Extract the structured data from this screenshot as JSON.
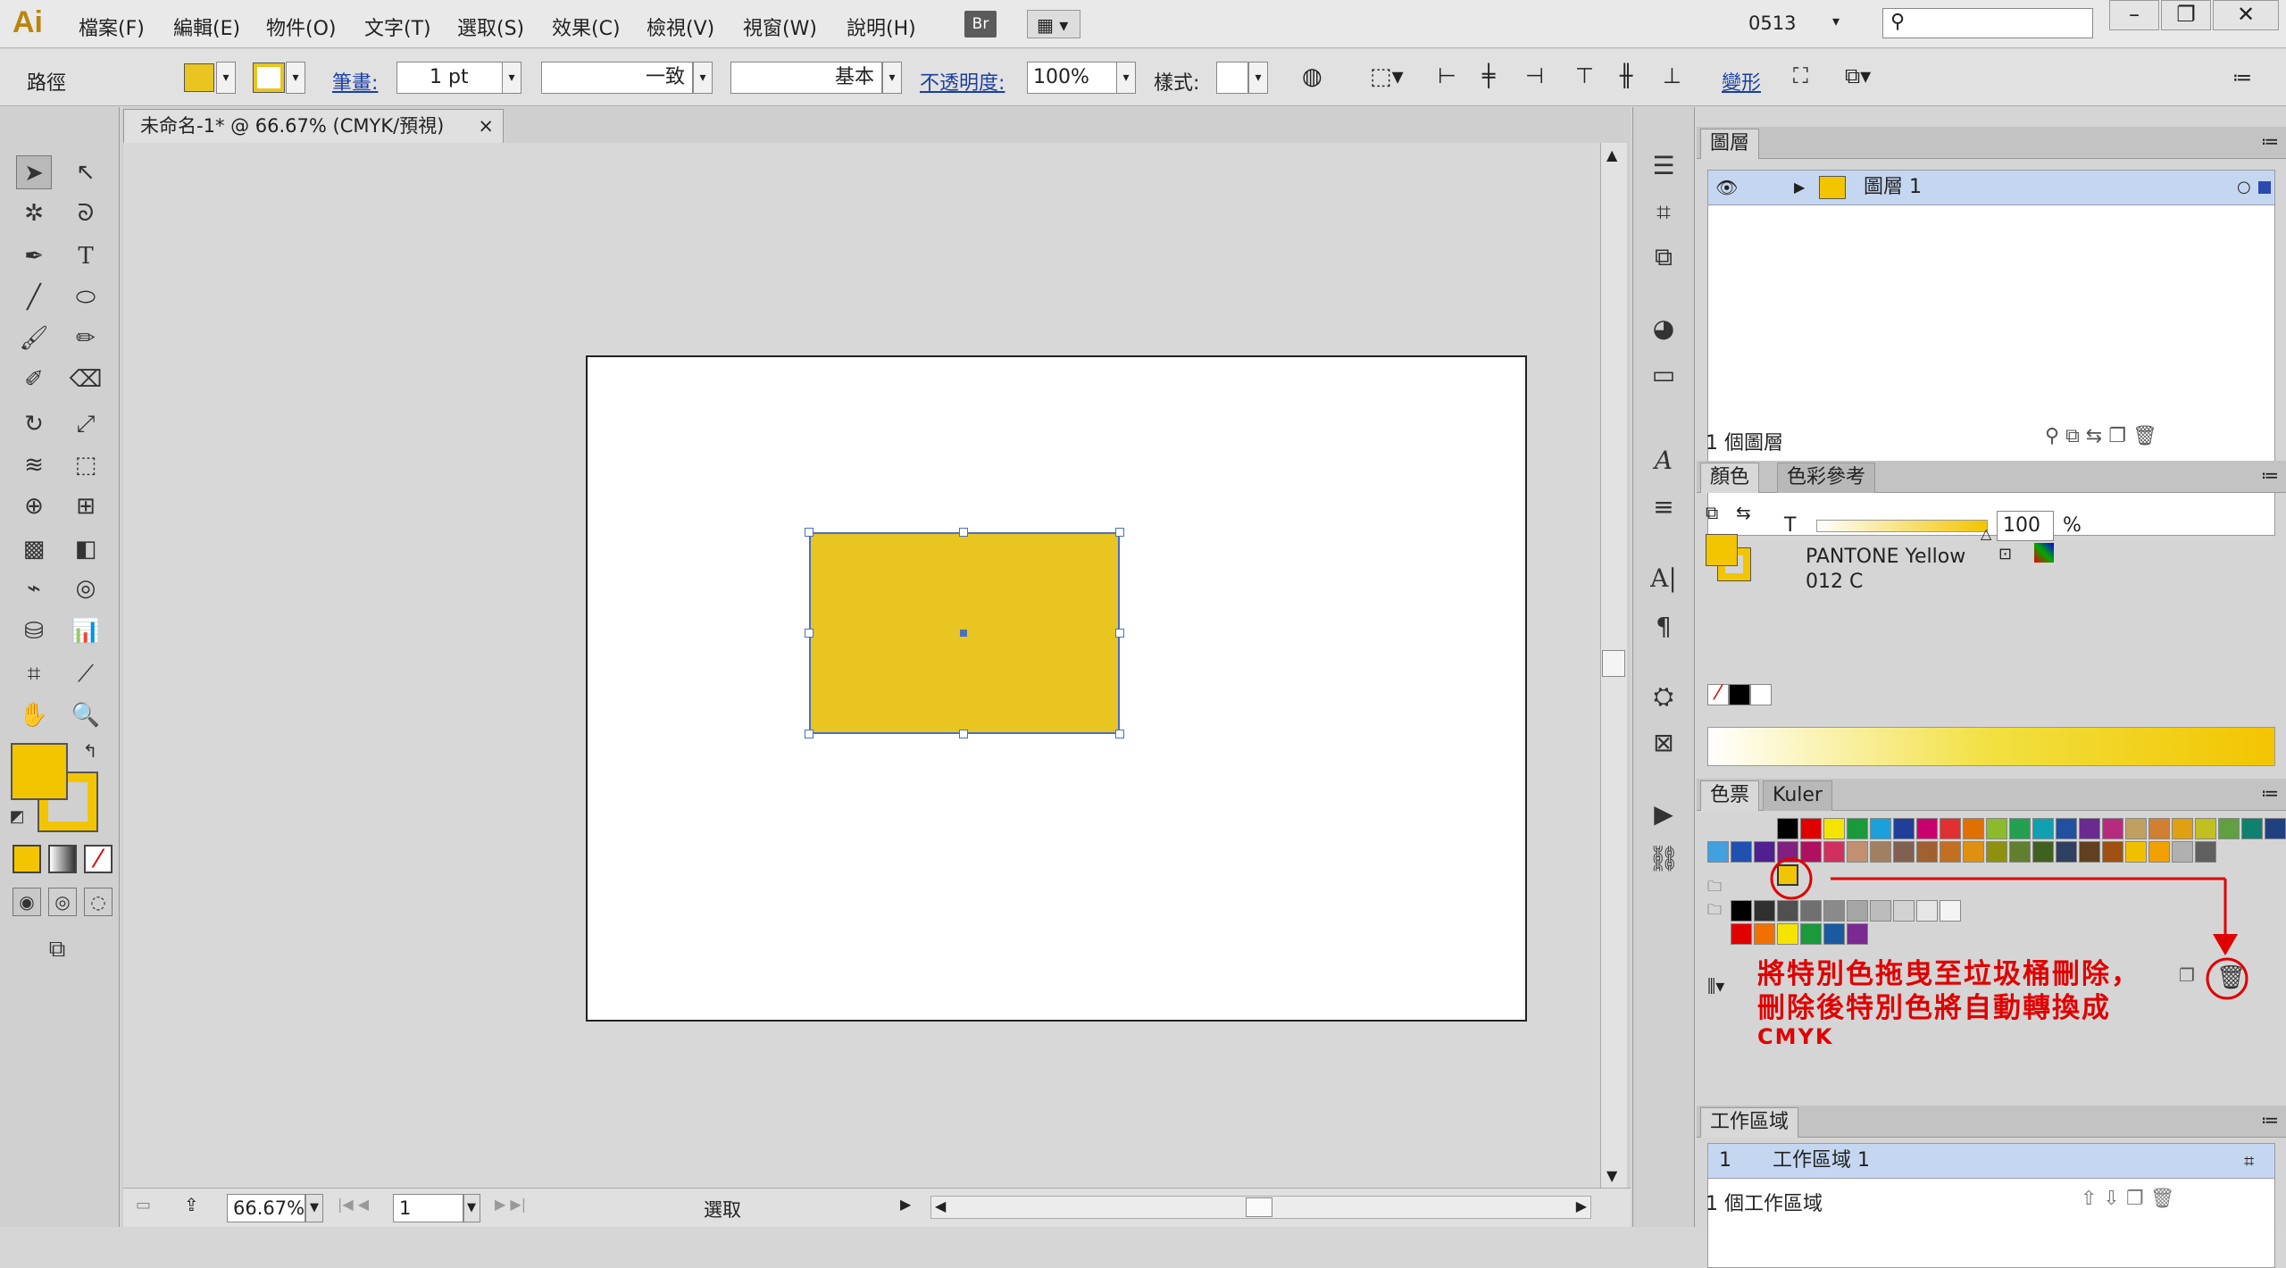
{
  "menubar": {
    "logo": "Ai",
    "menus": [
      "檔案(F)",
      "編輯(E)",
      "物件(O)",
      "文字(T)",
      "選取(S)",
      "效果(C)",
      "檢視(V)",
      "視窗(W)",
      "說明(H)"
    ],
    "bridge_label": "Br",
    "workspace_name": "0513",
    "search_placeholder": ""
  },
  "control": {
    "selection_label": "路徑",
    "stroke_label": "筆畫:",
    "stroke_weight": "1 pt",
    "stroke_profile": "一致",
    "brush_label": "基本",
    "opacity_label": "不透明度:",
    "opacity_value": "100%",
    "style_label": "樣式:",
    "transform_label": "變形"
  },
  "document": {
    "tab_title": "未命名-1* @ 66.67% (CMYK/預視)",
    "close": "×",
    "zoom": "66.67%",
    "page": "1",
    "status_text": "選取"
  },
  "layers": {
    "tab": "圖層",
    "layer_name": "圖層 1",
    "footer": "1 個圖層"
  },
  "color": {
    "tab_color": "顏色",
    "tab_guide": "色彩參考",
    "channel": "T",
    "value": "100",
    "unit": "%",
    "name_line1": "PANTONE Yellow",
    "name_line2": "012 C",
    "fill_color": "#f2c500"
  },
  "swatches": {
    "tab_swatches": "色票",
    "tab_kuler": "Kuler",
    "row1": [
      "#000000",
      "#e00000",
      "#f5e400",
      "#1a9a3a",
      "#1aa0dc",
      "#1f3f9a",
      "#c8006e",
      "#e03030",
      "#e07000",
      "#8bbb2a",
      "#22a050",
      "#10a0b0",
      "#2050a0",
      "#6a2a90",
      "#b82a80",
      "#c0a060",
      "#d08030",
      "#e0a010",
      "#c0c020",
      "#60a040",
      "#108070",
      "#204080"
    ],
    "row2": [
      "#40a0e0",
      "#2050b0",
      "#502090",
      "#802080",
      "#b01060",
      "#d03060",
      "#c09070",
      "#a08060",
      "#806050",
      "#a06030",
      "#c07020",
      "#e09010",
      "#909010",
      "#608030",
      "#406020",
      "#304060",
      "#604020",
      "#a05010",
      "#f0c000",
      "#f0a000",
      "#b0b0b0",
      "#606060"
    ],
    "row4": [
      "#000000",
      "#303030",
      "#505050",
      "#707070",
      "#8a8a8a",
      "#a5a5a5",
      "#bcbcbc",
      "#d2d2d2",
      "#e6e6e6",
      "#f4f4f4"
    ],
    "row5": [
      "#e00000",
      "#f07000",
      "#f5e400",
      "#1a9a3a",
      "#1a5aa0",
      "#7a2a90"
    ]
  },
  "artboards": {
    "tab": "工作區域",
    "row_index": "1",
    "row_name": "工作區域 1",
    "footer": "1 個工作區域"
  },
  "annotation": {
    "line1": "將特別色拖曳至垃圾桶刪除，",
    "line2": "刪除後特別色將自動轉換成",
    "line3": "CMYK",
    "color": "#e00000"
  }
}
